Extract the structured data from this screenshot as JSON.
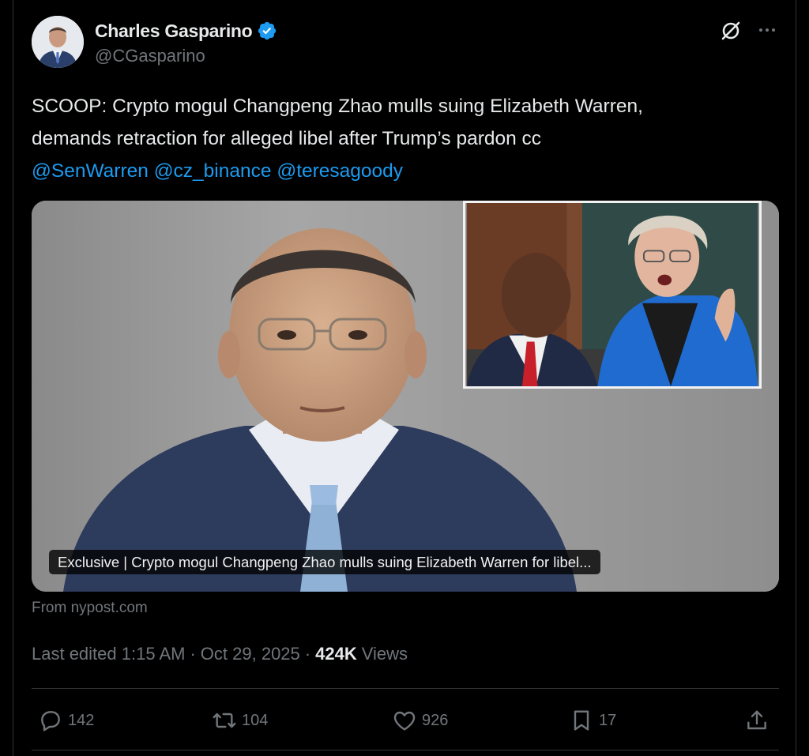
{
  "author": {
    "display_name": "Charles Gasparino",
    "handle": "@CGasparino",
    "verified_color": "#1d9bf0"
  },
  "tweet": {
    "text_line1": "SCOOP: Crypto mogul Changpeng Zhao mulls suing Elizabeth Warren,",
    "text_line2": "demands retraction for alleged libel after Trump’s pardon cc",
    "mentions": [
      "@SenWarren",
      "@cz_binance",
      "@teresagoody"
    ]
  },
  "link_card": {
    "caption": "Exclusive | Crypto mogul Changpeng Zhao mulls suing Elizabeth Warren for libel...",
    "source": "From nypost.com"
  },
  "meta": {
    "edited_label": "Last edited 1:15 AM",
    "date": "Oct 29, 2025",
    "separator": "·",
    "views_count": "424K",
    "views_label": "Views"
  },
  "actions": {
    "replies": "142",
    "reposts": "104",
    "likes": "926",
    "bookmarks": "17"
  },
  "icons": [
    "grok-icon",
    "more-icon",
    "reply-icon",
    "repost-icon",
    "like-icon",
    "bookmark-icon",
    "share-icon",
    "verified-icon"
  ],
  "colors": {
    "background": "#000000",
    "text": "#e7e9ea",
    "secondary": "#71767b",
    "accent": "#1d9bf0",
    "border": "#2f3336"
  }
}
